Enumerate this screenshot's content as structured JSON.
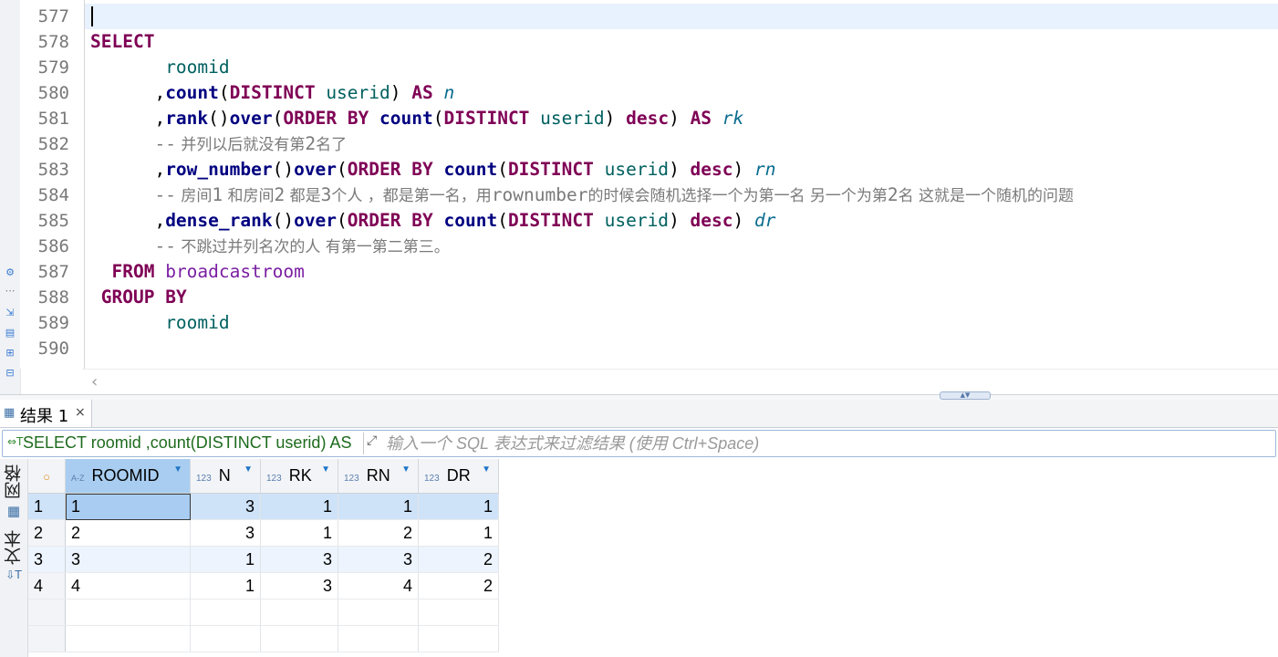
{
  "left_strip": {
    "icons": [
      "gear-icon",
      "more-dots-icon",
      "export-icon",
      "new-file-icon",
      "spreadsheet-icon",
      "layout-icon"
    ]
  },
  "editor": {
    "line_numbers": [
      "577",
      "578",
      "579",
      "580",
      "581",
      "582",
      "583",
      "584",
      "585",
      "586",
      "587",
      "588",
      "589",
      "590"
    ],
    "lines": [
      "",
      "SELECT",
      "       roomid",
      "      ,count(DISTINCT userid) AS n",
      "      ,rank()over(ORDER BY count(DISTINCT userid) desc) AS rk",
      "      -- 并列以后就没有第2名了",
      "      ,row_number()over(ORDER BY count(DISTINCT userid) desc) rn",
      "      -- 房间1 和房间2 都是3个人 ，都是第一名，用rownumber的时候会随机选择一个为第一名 另一个为第2名 这就是一个随机的问题",
      "      ,dense_rank()over(ORDER BY count(DISTINCT userid) desc) dr",
      "      -- 不跳过并列名次的人 有第一第二第三。",
      "  FROM broadcastroom",
      " GROUP BY",
      "       roomid",
      ""
    ]
  },
  "results_tab": {
    "label": "结果 1",
    "close": "×"
  },
  "filter": {
    "sql_text": "SELECT roomid ,count(DISTINCT userid) AS",
    "placeholder": "输入一个 SQL 表达式来过滤结果 (使用 Ctrl+Space)"
  },
  "view_switch": {
    "grid_label": "网格",
    "text_label": "文本"
  },
  "grid": {
    "columns": [
      {
        "type": "A-Z",
        "name": "ROOMID"
      },
      {
        "type": "123",
        "name": "N"
      },
      {
        "type": "123",
        "name": "RK"
      },
      {
        "type": "123",
        "name": "RN"
      },
      {
        "type": "123",
        "name": "DR"
      }
    ],
    "rows": [
      {
        "num": "1",
        "cells": [
          "1",
          "3",
          "1",
          "1",
          "1"
        ]
      },
      {
        "num": "2",
        "cells": [
          "2",
          "3",
          "1",
          "2",
          "1"
        ]
      },
      {
        "num": "3",
        "cells": [
          "3",
          "1",
          "3",
          "3",
          "2"
        ]
      },
      {
        "num": "4",
        "cells": [
          "4",
          "1",
          "3",
          "4",
          "2"
        ]
      }
    ]
  },
  "colors": {
    "keyword": "#7f0055",
    "function": "#000080",
    "column": "#006060",
    "table": "#7a1fa2",
    "alias": "#0a6c8f",
    "comment": "#7a7a7a"
  }
}
